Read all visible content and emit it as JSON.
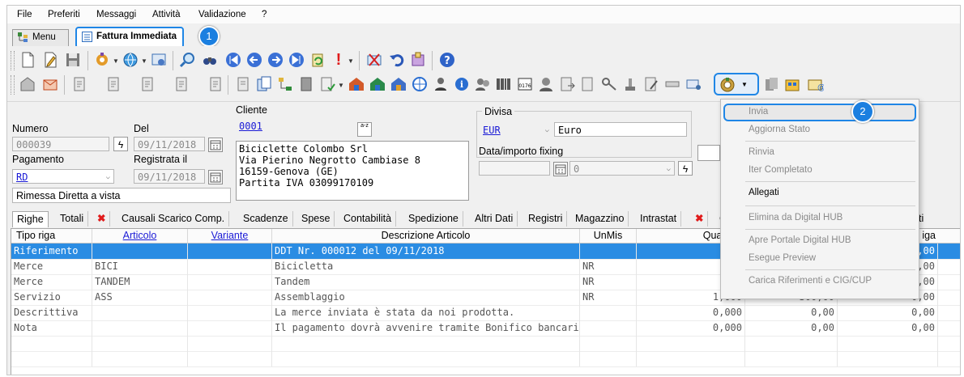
{
  "menubar": {
    "items": [
      "File",
      "Preferiti",
      "Messaggi",
      "Attività",
      "Validazione",
      "?"
    ]
  },
  "doc_tabs": {
    "menu": "Menu",
    "fattura": "Fattura Immediata"
  },
  "callouts": {
    "one": "1",
    "two": "2"
  },
  "form": {
    "numero_label": "Numero",
    "numero_value": "000039",
    "del_label": "Del",
    "del_value": "09/11/2018",
    "pagamento_label": "Pagamento",
    "pagamento_value": "RD",
    "registrata_label": "Registrata il",
    "registrata_value": "09/11/2018",
    "pagamento_desc": "Rimessa Diretta a vista",
    "cliente_label": "Cliente",
    "cliente_code": "0001",
    "cliente_address": [
      "Biciclette Colombo Srl",
      "Via Pierino Negrotto Cambiase 8",
      "16159-Genova (GE)",
      "Partita IVA 03099170109"
    ],
    "divisa_label": "Divisa",
    "divisa_code": "EUR",
    "divisa_desc": "Euro",
    "fixing_label": "Data/importo fixing",
    "fixing_value": "0",
    "az_label": "a-z"
  },
  "grid_tabs": [
    "Righe",
    "Totali",
    "Causali Scarico Comp.",
    "Scadenze",
    "Spese",
    "Contabilità",
    "Spedizione",
    "Altri Dati",
    "Registri",
    "Magazzino",
    "Intrastat",
    "C",
    "ti Incroci"
  ],
  "grid": {
    "headers": [
      "Tipo riga",
      "Articolo",
      "Variante",
      "Descrizione Articolo",
      "UnMis",
      "Quantità",
      "",
      "iga"
    ],
    "rows": [
      {
        "tipo": "Riferimento",
        "articolo": "",
        "variante": "",
        "descrizione": "DDT Nr. 000012 del 09/11/2018",
        "unmis": "",
        "quantita": "0,",
        "prezzo": "",
        "extra": "0,00"
      },
      {
        "tipo": "Merce",
        "articolo": "BICI",
        "variante": "",
        "descrizione": "Bicicletta",
        "unmis": "NR",
        "quantita": "1,",
        "prezzo": "",
        "extra": "0,00"
      },
      {
        "tipo": "Merce",
        "articolo": "TANDEM",
        "variante": "",
        "descrizione": "Tandem",
        "unmis": "NR",
        "quantita": "1,",
        "prezzo": "",
        "extra": "0,00"
      },
      {
        "tipo": "Servizio",
        "articolo": "ASS",
        "variante": "",
        "descrizione": "Assemblaggio",
        "unmis": "NR",
        "quantita": "1,000",
        "prezzo": "300,00",
        "extra": "0,00"
      },
      {
        "tipo": "Descrittiva",
        "articolo": "",
        "variante": "",
        "descrizione": "La merce inviata è stata da noi prodotta.",
        "unmis": "",
        "quantita": "0,000",
        "prezzo": "0,00",
        "extra": "0,00"
      },
      {
        "tipo": "Nota",
        "articolo": "",
        "variante": "",
        "descrizione": "Il pagamento dovrà avvenire tramite Bonifico bancario.",
        "unmis": "",
        "quantita": "0,000",
        "prezzo": "0,00",
        "extra": "0,00"
      }
    ]
  },
  "dropdown_menu": {
    "items": [
      "Invia",
      "Aggiorna Stato",
      "Rinvia",
      "Iter Completato",
      "Allegati",
      "Elimina da Digital HUB",
      "Apre Portale Digital HUB",
      "Esegue Preview",
      "Carica Riferimenti e CIG/CUP"
    ]
  },
  "colors": {
    "accent": "#2a8ce3",
    "callout": "#1b7fe0",
    "highlight": "#1f86e6"
  }
}
